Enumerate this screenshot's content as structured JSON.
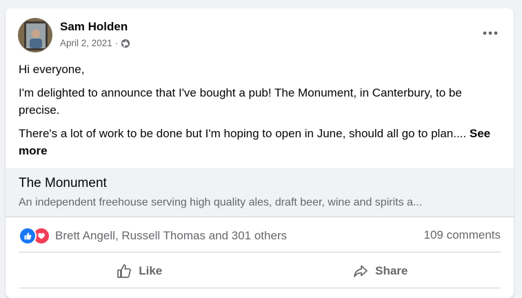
{
  "post": {
    "author": "Sam Holden",
    "date": "April 2, 2021",
    "separator": "·",
    "privacy_icon": "globe-icon",
    "more_icon": "more-options-icon",
    "paragraphs": [
      "Hi everyone,",
      "I'm delighted to announce that I've bought a pub! The Monument, in Canterbury, to be precise.",
      "There's a lot of work to be done but I'm hoping to open in June, should all go to plan...."
    ],
    "see_more": "See more"
  },
  "link_preview": {
    "title": "The Monument",
    "description": "An independent freehouse serving high quality ales, draft beer, wine and spirits a..."
  },
  "engagement": {
    "reaction_icons": [
      "like-reaction-icon",
      "love-reaction-icon"
    ],
    "reactors": "Brett Angell, Russell Thomas and 301 others",
    "comments": "109 comments"
  },
  "actions": {
    "like_label": "Like",
    "share_label": "Share"
  },
  "colors": {
    "like_blue": "#1877f2",
    "love_red": "#f33e58",
    "secondary_text": "#65676b",
    "preview_bg": "#f0f2f5"
  }
}
